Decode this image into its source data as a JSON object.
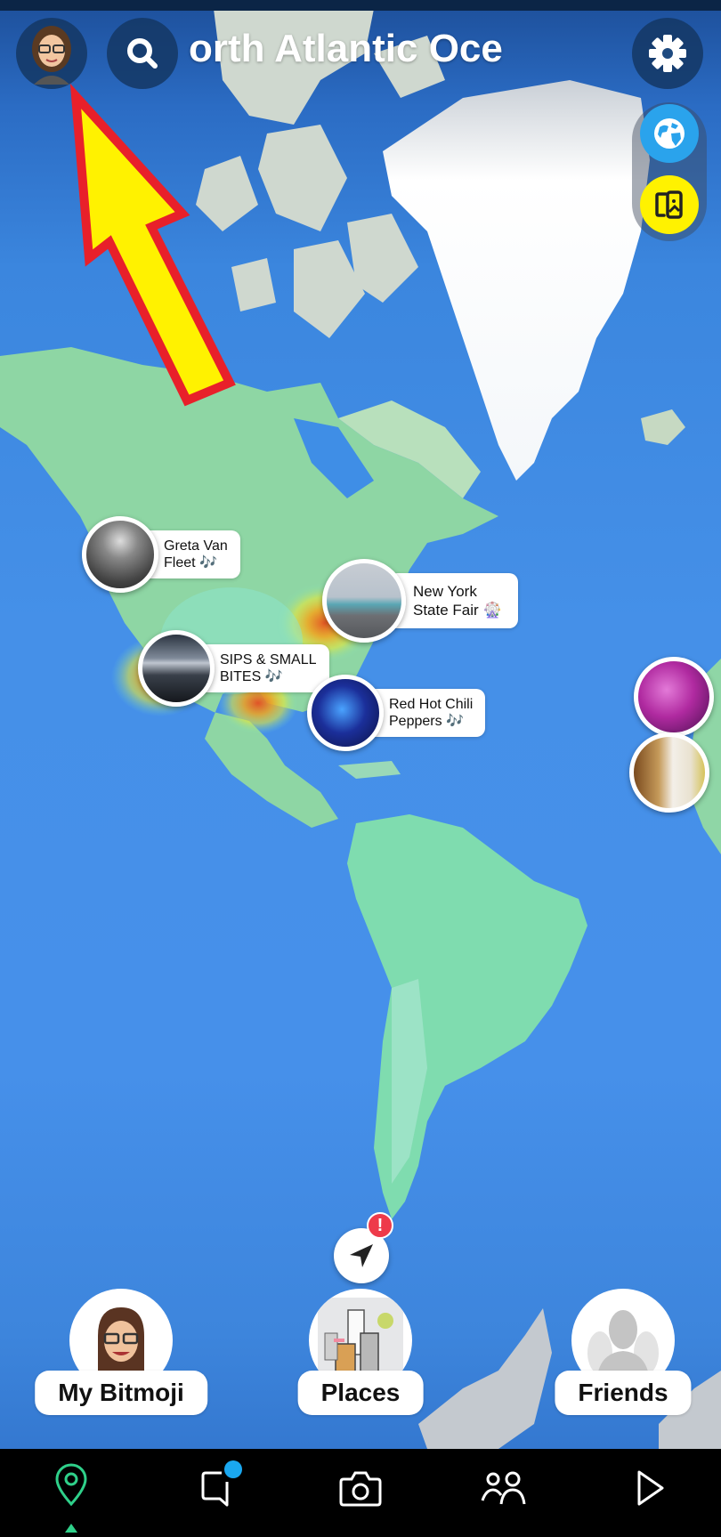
{
  "header": {
    "location_title": "orth Atlantic Oce",
    "profile_avatar": "bitmoji-avatar",
    "search_icon": "search-icon",
    "settings_icon": "gear-icon"
  },
  "side_controls": [
    {
      "name": "globe-icon",
      "color": "#2aa3ec"
    },
    {
      "name": "memories-icon",
      "color": "#fff200"
    }
  ],
  "stories": [
    {
      "title_line1": "Greta Van",
      "title_line2": "Fleet",
      "emoji": "🎶"
    },
    {
      "title_line1": "New York",
      "title_line2": "State Fair",
      "emoji": "🎡"
    },
    {
      "title_line1": "SIPS & SMALL",
      "title_line2": "BITES",
      "emoji": "🎶"
    },
    {
      "title_line1": "Red Hot Chili",
      "title_line2": "Peppers",
      "emoji": "🎶"
    }
  ],
  "edge_stories": [
    {
      "name": "story-thumb-concert-crowd"
    },
    {
      "name": "story-thumb-drinks"
    }
  ],
  "navigation": {
    "icon": "navigation-arrow-icon",
    "alert_badge": "!"
  },
  "dock": [
    {
      "label": "My Bitmoji"
    },
    {
      "label": "Places"
    },
    {
      "label": "Friends"
    }
  ],
  "tabbar": {
    "tabs": [
      "map",
      "chat",
      "camera",
      "stories",
      "spotlight"
    ],
    "active": "map",
    "active_color": "#2fd08a",
    "chat_badge_color": "#1aa8f0"
  },
  "annotation": {
    "type": "arrow",
    "fill": "#fff200",
    "stroke": "#e8202a",
    "points_to": "profile-avatar"
  }
}
